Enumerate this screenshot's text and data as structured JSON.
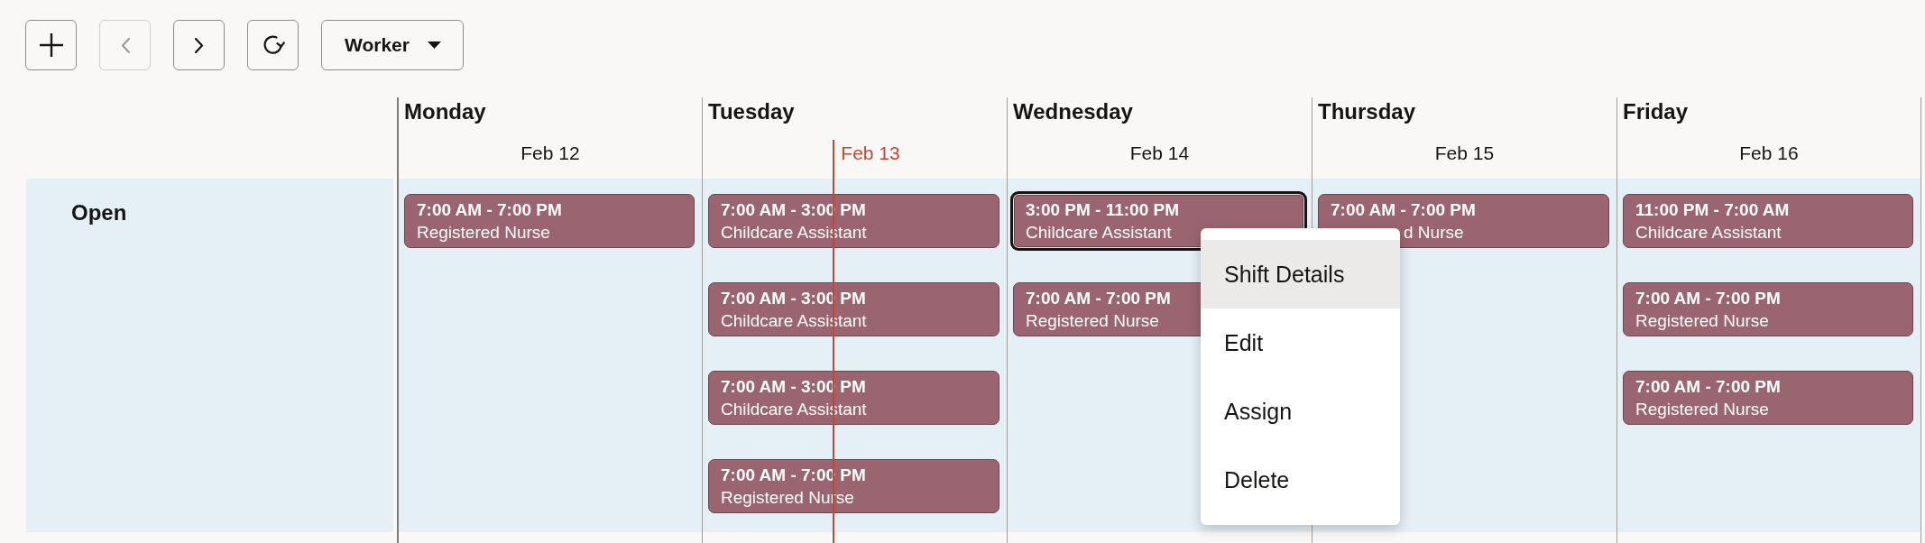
{
  "toolbar": {
    "buttons": [
      {
        "kind": "add",
        "disabled": false
      },
      {
        "kind": "previous",
        "disabled": true
      },
      {
        "kind": "next",
        "disabled": false
      },
      {
        "kind": "refresh",
        "disabled": false
      }
    ],
    "view_select": {
      "value": "Worker"
    }
  },
  "days": [
    {
      "name": "Monday",
      "date": "Feb 12",
      "today": false
    },
    {
      "name": "Tuesday",
      "date": "Feb 13",
      "today": true
    },
    {
      "name": "Wednesday",
      "date": "Feb 14",
      "today": false
    },
    {
      "name": "Thursday",
      "date": "Feb 15",
      "today": false
    },
    {
      "name": "Friday",
      "date": "Feb 16",
      "today": false
    }
  ],
  "rows": [
    {
      "label": "Open",
      "cells": [
        {
          "shifts": [
            {
              "kind": "plain",
              "time": "7:00 AM - 7:00 PM",
              "role": "Registered Nurse",
              "selected": false
            }
          ]
        },
        {
          "shifts": [
            {
              "kind": "plain",
              "time": "7:00 AM - 3:00 PM",
              "role": "Childcare Assistant",
              "selected": false
            },
            {
              "kind": "plain",
              "time": "7:00 AM - 3:00 PM",
              "role": "Childcare Assistant",
              "selected": false
            },
            {
              "kind": "plain",
              "time": "7:00 AM - 3:00 PM",
              "role": "Childcare Assistant",
              "selected": false
            },
            {
              "kind": "plain",
              "time": "7:00 AM - 7:00 PM",
              "role": "Registered Nurse",
              "selected": false
            }
          ]
        },
        {
          "shifts": [
            {
              "kind": "plain",
              "time": "3:00 PM - 11:00 PM",
              "role": "Childcare Assistant",
              "selected": true
            },
            {
              "kind": "plain",
              "time": "7:00 AM - 7:00 PM",
              "role": "Registered Nurse",
              "selected": false
            }
          ]
        },
        {
          "shifts": [
            {
              "kind": "overlapped",
              "time": "7:00 AM - 7:00 PM",
              "role": "d Nurse",
              "selected": false
            }
          ]
        },
        {
          "shifts": [
            {
              "kind": "plain",
              "time": "11:00 PM - 7:00 AM",
              "role": "Childcare Assistant",
              "selected": false
            },
            {
              "kind": "plain",
              "time": "7:00 AM - 7:00 PM",
              "role": "Registered Nurse",
              "selected": false
            },
            {
              "kind": "plain",
              "time": "7:00 AM - 7:00 PM",
              "role": "Registered Nurse",
              "selected": false
            }
          ]
        }
      ]
    }
  ],
  "context_menu": {
    "items": [
      {
        "label": "Shift Details",
        "selected": true
      },
      {
        "label": "Edit",
        "selected": false
      },
      {
        "label": "Assign",
        "selected": false
      },
      {
        "label": "Delete",
        "selected": false
      }
    ]
  }
}
